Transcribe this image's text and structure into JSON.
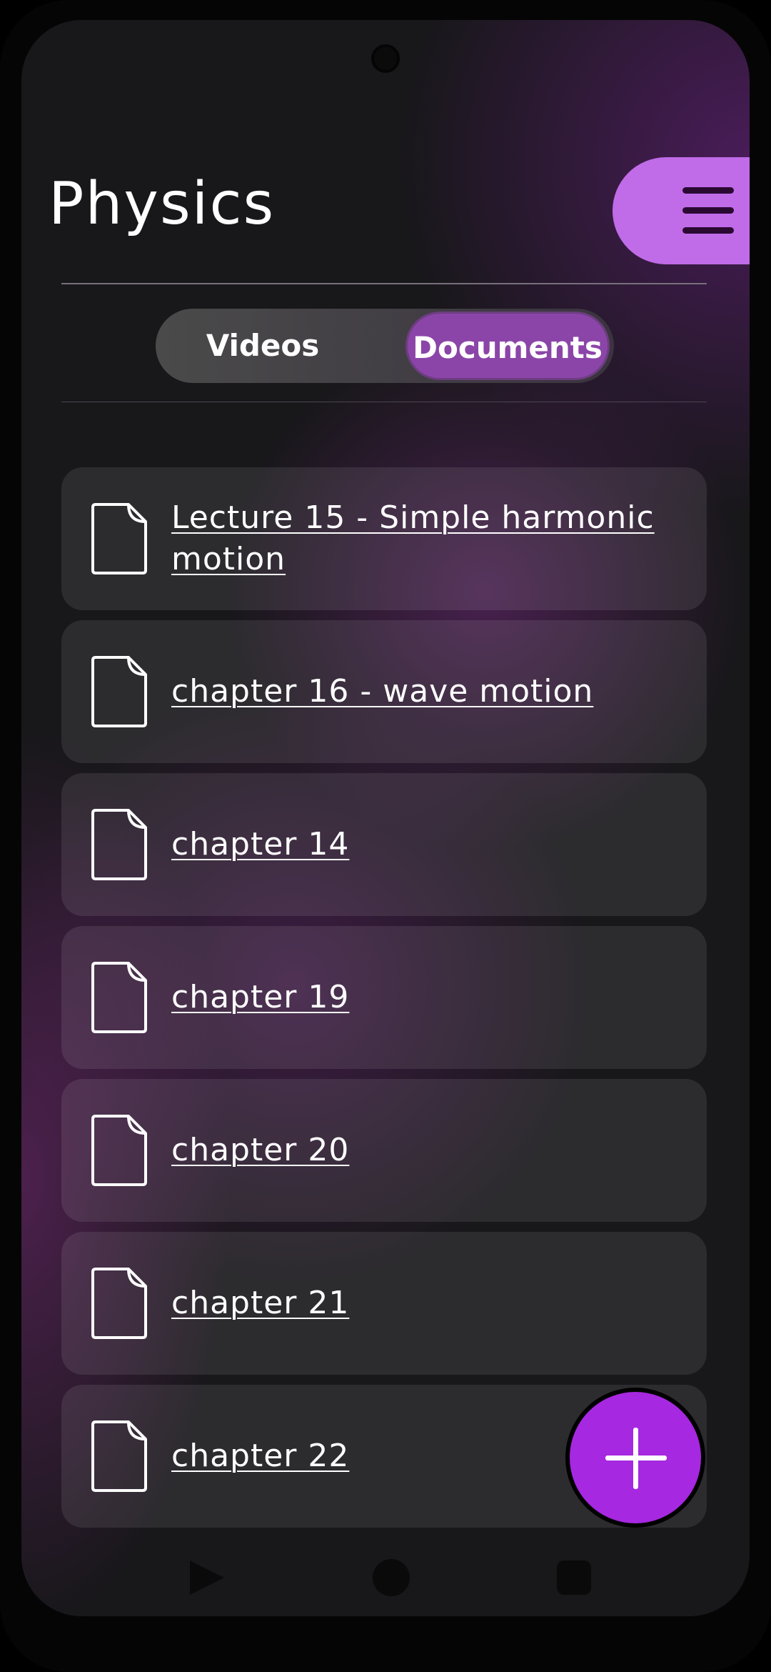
{
  "header": {
    "title": "Physics",
    "menu_icon": "hamburger-menu-icon"
  },
  "tabs": [
    {
      "label": "Videos",
      "selected": false
    },
    {
      "label": "Documents",
      "selected": true
    }
  ],
  "documents": [
    {
      "title": "Lecture 15 - Simple harmonic motion",
      "icon": "document-icon"
    },
    {
      "title": "chapter 16 - wave motion",
      "icon": "document-icon"
    },
    {
      "title": "chapter 14",
      "icon": "document-icon"
    },
    {
      "title": "chapter 19",
      "icon": "document-icon"
    },
    {
      "title": "chapter 20",
      "icon": "document-icon"
    },
    {
      "title": "chapter 21",
      "icon": "document-icon"
    },
    {
      "title": "chapter 22",
      "icon": "document-icon"
    }
  ],
  "fab": {
    "icon": "plus-icon"
  },
  "system_nav": {
    "back_icon": "back-triangle-icon",
    "home_icon": "home-circle-icon",
    "recents_icon": "recents-square-icon"
  },
  "colors": {
    "accent": "#c06be8",
    "selected_tab": "#8b45a8",
    "fab": "#a628e0",
    "background": "#18171a"
  }
}
